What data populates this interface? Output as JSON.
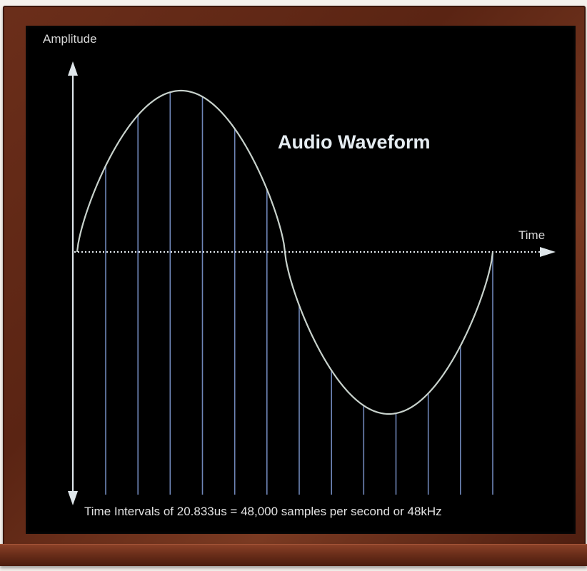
{
  "axes": {
    "y_label": "Amplitude",
    "x_label": "Time"
  },
  "title": "Audio Waveform",
  "caption": "Time Intervals of 20.833us = 48,000 samples per second or 48kHz",
  "colors": {
    "board": "#000000",
    "frame": "#5a2413",
    "waveform": "#c8d2cc",
    "sample_lines": "#6f86b8",
    "axis": "#dfe6ea"
  },
  "sampling": {
    "sample_count": 13
  }
}
